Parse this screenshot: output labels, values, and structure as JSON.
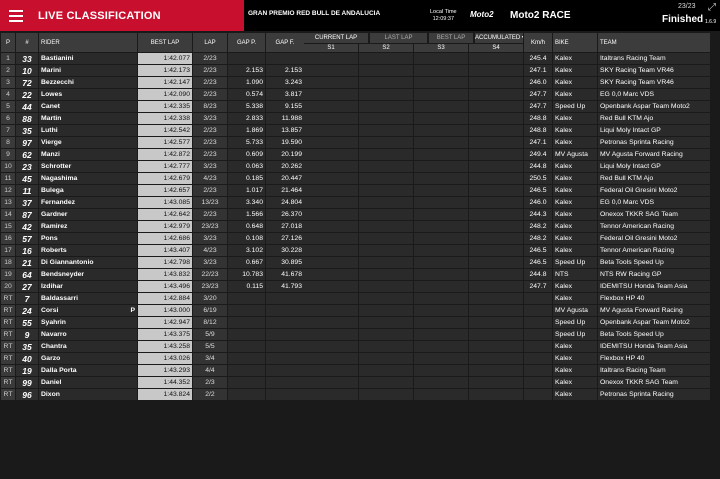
{
  "header": {
    "title": "LIVE CLASSIFICATION",
    "event": "GRAN PREMIO RED BULL DE ANDALUCIA",
    "local_time_label": "Local Time",
    "local_time": "12:09:37",
    "series_logo": "Moto2",
    "race": "Moto2 RACE",
    "lap_counter": "23/23",
    "status": "Finished",
    "version": "1.6.9"
  },
  "controls": {
    "current_lap": "CURRENT LAP",
    "last_lap": "LAST LAP",
    "best_lap": "BEST LAP",
    "accumulated": "ACCUMULATED"
  },
  "columns": {
    "p": "P",
    "num": "#",
    "rider": "RIDER",
    "best": "BEST LAP",
    "lap": "LAP",
    "gap_p": "GAP P.",
    "gap_f": "GAP F.",
    "s1": "S1",
    "s2": "S2",
    "s3": "S3",
    "s4": "S4",
    "kmh": "Km/h",
    "bike": "BIKE",
    "team": "TEAM"
  },
  "rows": [
    {
      "p": "1",
      "num": "33",
      "rider": "Bastianini",
      "best": "1:42.077",
      "lap": "2/23",
      "gp": "",
      "gf": "",
      "kmh": "245.4",
      "bike": "Kalex",
      "team": "Italtrans Racing Team"
    },
    {
      "p": "2",
      "num": "10",
      "rider": "Marini",
      "best": "1:42.173",
      "lap": "2/23",
      "gp": "2.153",
      "gf": "2.153",
      "kmh": "247.1",
      "bike": "Kalex",
      "team": "SKY Racing Team VR46"
    },
    {
      "p": "3",
      "num": "72",
      "rider": "Bezzecchi",
      "best": "1:42.147",
      "lap": "2/23",
      "gp": "1.090",
      "gf": "3.243",
      "kmh": "246.0",
      "bike": "Kalex",
      "team": "SKY Racing Team VR46"
    },
    {
      "p": "4",
      "num": "22",
      "rider": "Lowes",
      "best": "1:42.090",
      "lap": "2/23",
      "gp": "0.574",
      "gf": "3.817",
      "kmh": "247.7",
      "bike": "Kalex",
      "team": "EG 0,0 Marc VDS"
    },
    {
      "p": "5",
      "num": "44",
      "rider": "Canet",
      "best": "1:42.335",
      "lap": "8/23",
      "gp": "5.338",
      "gf": "9.155",
      "kmh": "247.7",
      "bike": "Speed Up",
      "team": "Openbank Aspar Team Moto2"
    },
    {
      "p": "6",
      "num": "88",
      "rider": "Martin",
      "best": "1:42.338",
      "lap": "3/23",
      "gp": "2.833",
      "gf": "11.988",
      "kmh": "248.8",
      "bike": "Kalex",
      "team": "Red Bull KTM Ajo"
    },
    {
      "p": "7",
      "num": "35",
      "rider": "Luthi",
      "best": "1:42.542",
      "lap": "2/23",
      "gp": "1.869",
      "gf": "13.857",
      "kmh": "248.8",
      "bike": "Kalex",
      "team": "Liqui Moly Intact GP"
    },
    {
      "p": "8",
      "num": "97",
      "rider": "Vierge",
      "best": "1:42.577",
      "lap": "2/23",
      "gp": "5.733",
      "gf": "19.590",
      "kmh": "247.1",
      "bike": "Kalex",
      "team": "Petronas Sprinta Racing"
    },
    {
      "p": "9",
      "num": "62",
      "rider": "Manzi",
      "best": "1:42.872",
      "lap": "2/23",
      "gp": "0.609",
      "gf": "20.199",
      "kmh": "249.4",
      "bike": "MV Agusta",
      "team": "MV Agusta Forward Racing"
    },
    {
      "p": "10",
      "num": "23",
      "rider": "Schrotter",
      "best": "1:42.777",
      "lap": "3/23",
      "gp": "0.063",
      "gf": "20.262",
      "kmh": "244.8",
      "bike": "Kalex",
      "team": "Liqui Moly Intact GP"
    },
    {
      "p": "11",
      "num": "45",
      "rider": "Nagashima",
      "best": "1:42.679",
      "lap": "4/23",
      "gp": "0.185",
      "gf": "20.447",
      "kmh": "250.5",
      "bike": "Kalex",
      "team": "Red Bull KTM Ajo"
    },
    {
      "p": "12",
      "num": "11",
      "rider": "Bulega",
      "best": "1:42.657",
      "lap": "2/23",
      "gp": "1.017",
      "gf": "21.464",
      "kmh": "246.5",
      "bike": "Kalex",
      "team": "Federal Oil Gresini Moto2"
    },
    {
      "p": "13",
      "num": "37",
      "rider": "Fernandez",
      "best": "1:43.085",
      "lap": "13/23",
      "gp": "3.340",
      "gf": "24.804",
      "kmh": "246.0",
      "bike": "Kalex",
      "team": "EG 0,0 Marc VDS"
    },
    {
      "p": "14",
      "num": "87",
      "rider": "Gardner",
      "best": "1:42.642",
      "lap": "2/23",
      "gp": "1.566",
      "gf": "26.370",
      "kmh": "244.3",
      "bike": "Kalex",
      "team": "Onexox TKKR SAG Team"
    },
    {
      "p": "15",
      "num": "42",
      "rider": "Ramirez",
      "best": "1:42.979",
      "lap": "23/23",
      "gp": "0.648",
      "gf": "27.018",
      "kmh": "248.2",
      "bike": "Kalex",
      "team": "Tennor American Racing"
    },
    {
      "p": "16",
      "num": "57",
      "rider": "Pons",
      "best": "1:42.686",
      "lap": "3/23",
      "gp": "0.108",
      "gf": "27.126",
      "kmh": "248.2",
      "bike": "Kalex",
      "team": "Federal Oil Gresini Moto2"
    },
    {
      "p": "17",
      "num": "16",
      "rider": "Roberts",
      "best": "1:43.407",
      "lap": "4/23",
      "gp": "3.102",
      "gf": "30.228",
      "kmh": "246.5",
      "bike": "Kalex",
      "team": "Tennor American Racing"
    },
    {
      "p": "18",
      "num": "21",
      "rider": "Di Giannantonio",
      "best": "1:42.798",
      "lap": "3/23",
      "gp": "0.667",
      "gf": "30.895",
      "kmh": "246.5",
      "bike": "Speed Up",
      "team": "Beta Tools Speed Up"
    },
    {
      "p": "19",
      "num": "64",
      "rider": "Bendsneyder",
      "best": "1:43.832",
      "lap": "22/23",
      "gp": "10.783",
      "gf": "41.678",
      "kmh": "244.8",
      "bike": "NTS",
      "team": "NTS RW Racing GP"
    },
    {
      "p": "20",
      "num": "27",
      "rider": "Izdihar",
      "best": "1:43.496",
      "lap": "23/23",
      "gp": "0.115",
      "gf": "41.793",
      "kmh": "247.7",
      "bike": "Kalex",
      "team": "IDEMITSU Honda Team Asia"
    },
    {
      "p": "RT",
      "num": "7",
      "rider": "Baldassarri",
      "best": "1:42.884",
      "lap": "3/20",
      "gp": "",
      "gf": "",
      "kmh": "",
      "bike": "Kalex",
      "team": "Flexbox HP 40"
    },
    {
      "p": "RT",
      "num": "24",
      "rider": "Corsi",
      "best": "1:43.000",
      "lap": "6/19",
      "gp": "",
      "gf": "",
      "kmh": "",
      "bike": "MV Agusta",
      "team": "MV Agusta Forward Racing",
      "flag": "P"
    },
    {
      "p": "RT",
      "num": "55",
      "rider": "Syahrin",
      "best": "1:42.947",
      "lap": "8/12",
      "gp": "",
      "gf": "",
      "kmh": "",
      "bike": "Speed Up",
      "team": "Openbank Aspar Team Moto2"
    },
    {
      "p": "RT",
      "num": "9",
      "rider": "Navarro",
      "best": "1:43.375",
      "lap": "5/9",
      "gp": "",
      "gf": "",
      "kmh": "",
      "bike": "Speed Up",
      "team": "Beta Tools Speed Up"
    },
    {
      "p": "RT",
      "num": "35",
      "rider": "Chantra",
      "best": "1:43.258",
      "lap": "5/5",
      "gp": "",
      "gf": "",
      "kmh": "",
      "bike": "Kalex",
      "team": "IDEMITSU Honda Team Asia"
    },
    {
      "p": "RT",
      "num": "40",
      "rider": "Garzo",
      "best": "1:43.026",
      "lap": "3/4",
      "gp": "",
      "gf": "",
      "kmh": "",
      "bike": "Kalex",
      "team": "Flexbox HP 40"
    },
    {
      "p": "RT",
      "num": "19",
      "rider": "Dalla Porta",
      "best": "1:43.293",
      "lap": "4/4",
      "gp": "",
      "gf": "",
      "kmh": "",
      "bike": "Kalex",
      "team": "Italtrans Racing Team"
    },
    {
      "p": "RT",
      "num": "99",
      "rider": "Daniel",
      "best": "1:44.352",
      "lap": "2/3",
      "gp": "",
      "gf": "",
      "kmh": "",
      "bike": "Kalex",
      "team": "Onexox TKKR SAG Team"
    },
    {
      "p": "RT",
      "num": "96",
      "rider": "Dixon",
      "best": "1:43.824",
      "lap": "2/2",
      "gp": "",
      "gf": "",
      "kmh": "",
      "bike": "Kalex",
      "team": "Petronas Sprinta Racing"
    }
  ]
}
